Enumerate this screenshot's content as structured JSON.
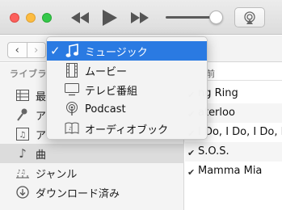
{
  "transport": {
    "rewind_icon": "rewind-icon",
    "play_icon": "play-icon",
    "forward_icon": "fast-forward-icon",
    "volume_level": 0.9,
    "airplay_icon": "airplay-icon"
  },
  "nav": {
    "back": "‹",
    "forward": "›"
  },
  "sidebar": {
    "header": "ライブラ",
    "items": [
      {
        "label": "最",
        "icon": "grid-icon"
      },
      {
        "label": "ア",
        "icon": "microphone-icon"
      },
      {
        "label": "ア",
        "icon": "album-icon"
      },
      {
        "label": "曲",
        "icon": "music-note-icon",
        "selected": true
      },
      {
        "label": "ジャンル",
        "icon": "genre-icon"
      },
      {
        "label": "ダウンロード済み",
        "icon": "download-icon"
      }
    ]
  },
  "songs": {
    "header": "前",
    "rows": [
      {
        "checked": true,
        "title": "ng Ring"
      },
      {
        "checked": true,
        "title": "aterloo"
      },
      {
        "checked": true,
        "title": "I Do, I Do, I Do, I"
      },
      {
        "checked": true,
        "title": "S.O.S."
      },
      {
        "checked": true,
        "title": "Mamma Mia"
      }
    ]
  },
  "menu": {
    "items": [
      {
        "label": "ミュージック",
        "icon": "music-note-icon",
        "selected": true
      },
      {
        "label": "ムービー",
        "icon": "film-icon"
      },
      {
        "label": "テレビ番組",
        "icon": "tv-icon"
      },
      {
        "label": "Podcast",
        "icon": "podcast-icon"
      },
      {
        "label": "オーディオブック",
        "icon": "audiobook-icon"
      }
    ]
  },
  "colors": {
    "accent": "#2a7ae2"
  }
}
